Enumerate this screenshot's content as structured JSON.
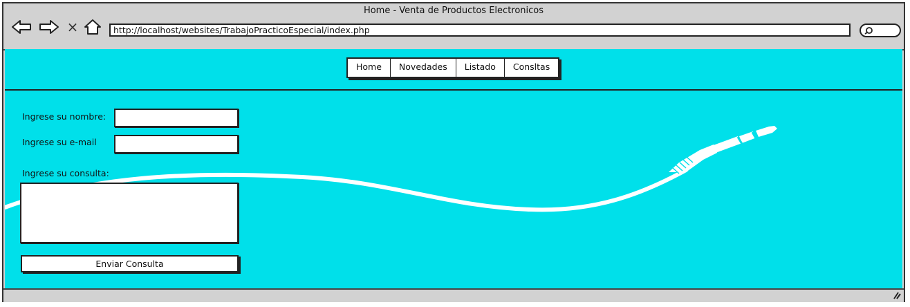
{
  "window": {
    "title": "Home - Venta de Productos Electronicos",
    "url": "http://localhost/websites/TrabajoPracticoEspecial/index.php",
    "nav_icons": [
      "back-arrow-icon",
      "forward-arrow-icon",
      "close-icon",
      "home-icon"
    ],
    "stop_glyph": "×"
  },
  "menu": {
    "items": [
      {
        "label": "Home"
      },
      {
        "label": "Novedades"
      },
      {
        "label": "Listado"
      },
      {
        "label": "Consltas"
      }
    ]
  },
  "form": {
    "name_label": "Ingrese su nombre:",
    "name_value": "",
    "email_label": "Ingrese su e-mail",
    "email_value": "",
    "query_label": "Ingrese su consulta:",
    "query_value": "",
    "submit_label": "Enviar Consulta"
  },
  "colors": {
    "background": "#00e0ea",
    "chrome": "#d2d2d2"
  }
}
